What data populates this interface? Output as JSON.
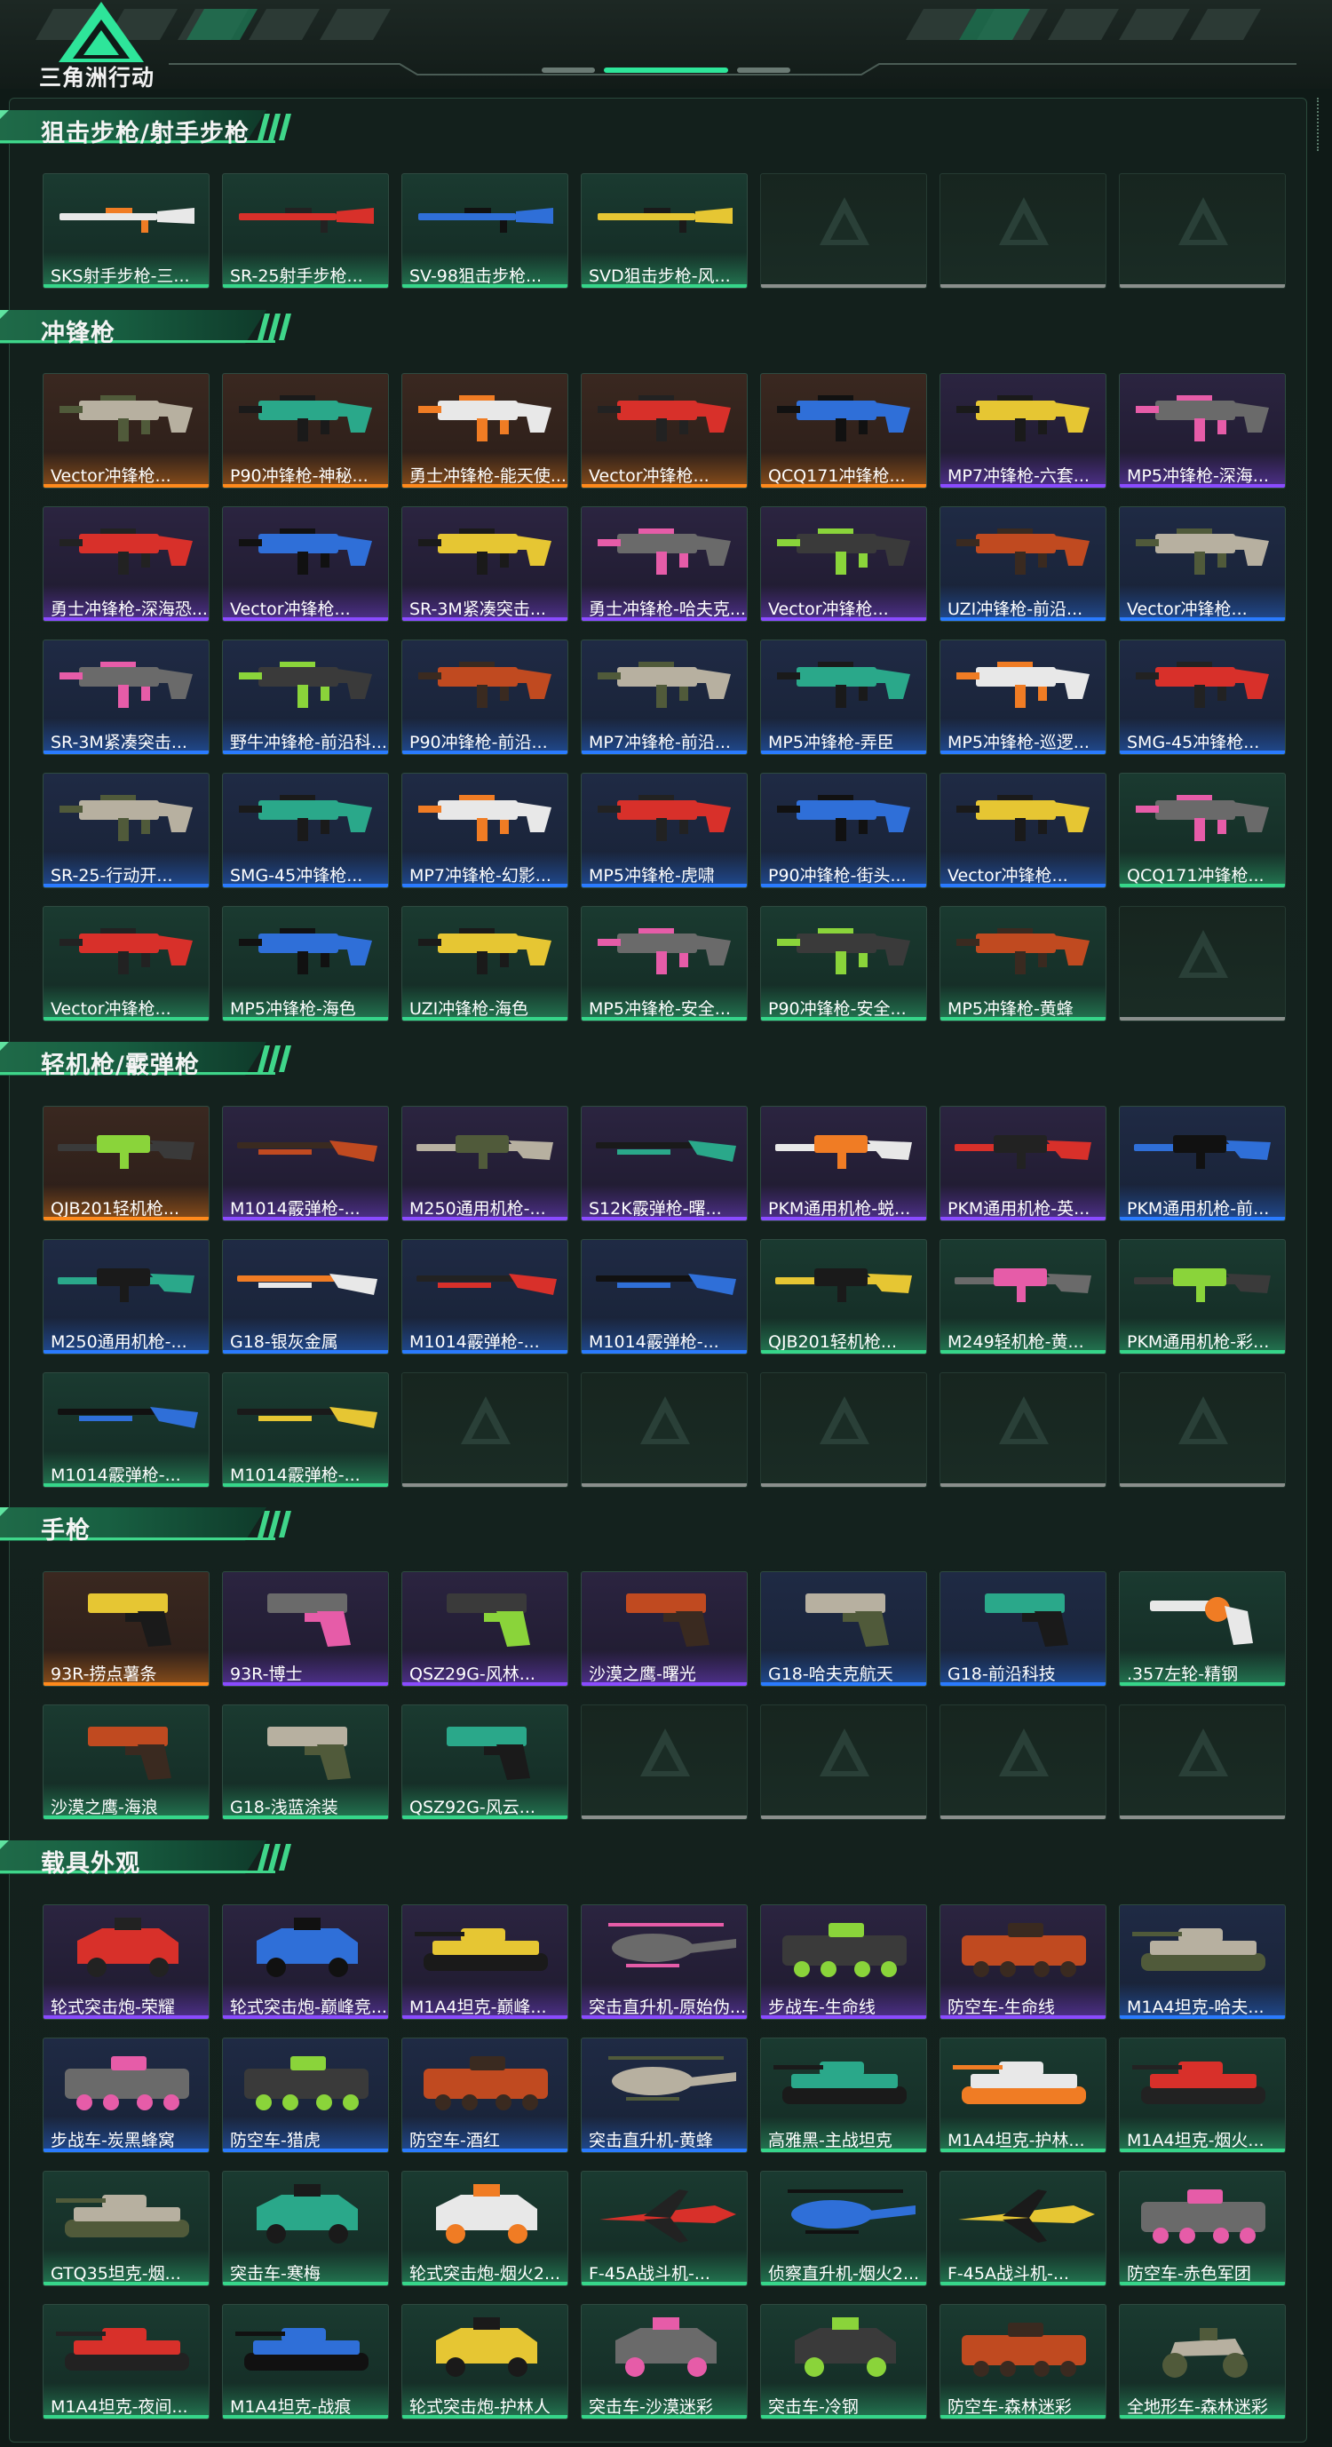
{
  "header": {
    "logo_text": "三角洲行动"
  },
  "rarity_colors": {
    "orange": "#ff8a1c",
    "purple": "#8a4bff",
    "blue": "#2a7bff",
    "green": "#36d68a",
    "gray": "#8a8f8c"
  },
  "sections": [
    {
      "title": "狙击步枪/射手步枪",
      "rows": [
        [
          {
            "name": "SKS射手步枪-三...",
            "r": "green",
            "icon": "rifle-icon"
          },
          {
            "name": "SR-25射手步枪...",
            "r": "green",
            "icon": "rifle-icon"
          },
          {
            "name": "SV-98狙击步枪...",
            "r": "green",
            "icon": "rifle-icon"
          },
          {
            "name": "SVD狙击步枪-风...",
            "r": "green",
            "icon": "rifle-icon"
          },
          null,
          null,
          null
        ]
      ]
    },
    {
      "title": "冲锋枪",
      "rows": [
        [
          {
            "name": "Vector冲锋枪...",
            "r": "orange",
            "icon": "smg-icon"
          },
          {
            "name": "P90冲锋枪-神秘...",
            "r": "orange",
            "icon": "smg-icon"
          },
          {
            "name": "勇士冲锋枪-能天使...",
            "r": "orange",
            "icon": "smg-icon"
          },
          {
            "name": "Vector冲锋枪...",
            "r": "orange",
            "icon": "smg-icon"
          },
          {
            "name": "QCQ171冲锋枪...",
            "r": "orange",
            "icon": "smg-icon"
          },
          {
            "name": "MP7冲锋枪-六套...",
            "r": "purple",
            "icon": "smg-icon"
          },
          {
            "name": "MP5冲锋枪-深海...",
            "r": "purple",
            "icon": "smg-icon"
          }
        ],
        [
          {
            "name": "勇士冲锋枪-深海恐...",
            "r": "purple",
            "icon": "smg-icon"
          },
          {
            "name": "Vector冲锋枪...",
            "r": "purple",
            "icon": "smg-icon"
          },
          {
            "name": "SR-3M紧凑突击...",
            "r": "purple",
            "icon": "smg-icon"
          },
          {
            "name": "勇士冲锋枪-哈夫克...",
            "r": "purple",
            "icon": "smg-icon"
          },
          {
            "name": "Vector冲锋枪...",
            "r": "purple",
            "icon": "smg-icon"
          },
          {
            "name": "UZI冲锋枪-前沿...",
            "r": "blue",
            "icon": "smg-icon"
          },
          {
            "name": "Vector冲锋枪...",
            "r": "blue",
            "icon": "smg-icon"
          }
        ],
        [
          {
            "name": "SR-3M紧凑突击...",
            "r": "blue",
            "icon": "smg-icon"
          },
          {
            "name": "野牛冲锋枪-前沿科...",
            "r": "blue",
            "icon": "smg-icon"
          },
          {
            "name": "P90冲锋枪-前沿...",
            "r": "blue",
            "icon": "smg-icon"
          },
          {
            "name": "MP7冲锋枪-前沿...",
            "r": "blue",
            "icon": "smg-icon"
          },
          {
            "name": "MP5冲锋枪-弄臣",
            "r": "blue",
            "icon": "smg-icon"
          },
          {
            "name": "MP5冲锋枪-巡逻...",
            "r": "blue",
            "icon": "smg-icon"
          },
          {
            "name": "SMG-45冲锋枪...",
            "r": "blue",
            "icon": "smg-icon"
          }
        ],
        [
          {
            "name": "SR-25-行动开...",
            "r": "blue",
            "icon": "smg-icon"
          },
          {
            "name": "SMG-45冲锋枪...",
            "r": "blue",
            "icon": "smg-icon"
          },
          {
            "name": "MP7冲锋枪-幻影...",
            "r": "blue",
            "icon": "smg-icon"
          },
          {
            "name": "MP5冲锋枪-虎啸",
            "r": "blue",
            "icon": "smg-icon"
          },
          {
            "name": "P90冲锋枪-街头...",
            "r": "blue",
            "icon": "smg-icon"
          },
          {
            "name": "Vector冲锋枪...",
            "r": "blue",
            "icon": "smg-icon"
          },
          {
            "name": "QCQ171冲锋枪...",
            "r": "green",
            "icon": "smg-icon"
          }
        ],
        [
          {
            "name": "Vector冲锋枪...",
            "r": "green",
            "icon": "smg-icon"
          },
          {
            "name": "MP5冲锋枪-海色",
            "r": "green",
            "icon": "smg-icon"
          },
          {
            "name": "UZI冲锋枪-海色",
            "r": "green",
            "icon": "smg-icon"
          },
          {
            "name": "MP5冲锋枪-安全...",
            "r": "green",
            "icon": "smg-icon"
          },
          {
            "name": "P90冲锋枪-安全...",
            "r": "green",
            "icon": "smg-icon"
          },
          {
            "name": "MP5冲锋枪-黄蜂",
            "r": "green",
            "icon": "smg-icon"
          },
          null
        ]
      ]
    },
    {
      "title": "轻机枪/霰弹枪",
      "rows": [
        [
          {
            "name": "QJB201轻机枪...",
            "r": "orange",
            "icon": "machine-gun-icon"
          },
          {
            "name": "M1014霰弹枪-...",
            "r": "purple",
            "icon": "shotgun-icon"
          },
          {
            "name": "M250通用机枪-...",
            "r": "purple",
            "icon": "machine-gun-icon"
          },
          {
            "name": "S12K霰弹枪-曙...",
            "r": "purple",
            "icon": "shotgun-icon"
          },
          {
            "name": "PKM通用机枪-蜕...",
            "r": "purple",
            "icon": "machine-gun-icon"
          },
          {
            "name": "PKM通用机枪-英...",
            "r": "purple",
            "icon": "machine-gun-icon"
          },
          {
            "name": "PKM通用机枪-前...",
            "r": "blue",
            "icon": "machine-gun-icon"
          }
        ],
        [
          {
            "name": "M250通用机枪-...",
            "r": "blue",
            "icon": "machine-gun-icon"
          },
          {
            "name": "G18-银灰金属",
            "r": "blue",
            "icon": "shotgun-icon"
          },
          {
            "name": "M1014霰弹枪-...",
            "r": "blue",
            "icon": "shotgun-icon"
          },
          {
            "name": "M1014霰弹枪-...",
            "r": "blue",
            "icon": "shotgun-icon"
          },
          {
            "name": "QJB201轻机枪...",
            "r": "green",
            "icon": "machine-gun-icon"
          },
          {
            "name": "M249轻机枪-黄...",
            "r": "green",
            "icon": "machine-gun-icon"
          },
          {
            "name": "PKM通用机枪-彩...",
            "r": "green",
            "icon": "machine-gun-icon"
          }
        ],
        [
          {
            "name": "M1014霰弹枪-...",
            "r": "green",
            "icon": "shotgun-icon"
          },
          {
            "name": "M1014霰弹枪-...",
            "r": "green",
            "icon": "shotgun-icon"
          },
          null,
          null,
          null,
          null,
          null
        ]
      ]
    },
    {
      "title": "手枪",
      "rows": [
        [
          {
            "name": "93R-捞点薯条",
            "r": "orange",
            "icon": "pistol-icon"
          },
          {
            "name": "93R-博士",
            "r": "purple",
            "icon": "pistol-icon"
          },
          {
            "name": "QSZ29G-风林...",
            "r": "purple",
            "icon": "pistol-icon"
          },
          {
            "name": "沙漠之鹰-曙光",
            "r": "purple",
            "icon": "pistol-icon"
          },
          {
            "name": "G18-哈夫克航天",
            "r": "blue",
            "icon": "pistol-icon"
          },
          {
            "name": "G18-前沿科技",
            "r": "blue",
            "icon": "pistol-icon"
          },
          {
            "name": ".357左轮-精钢",
            "r": "green",
            "icon": "revolver-icon"
          }
        ],
        [
          {
            "name": "沙漠之鹰-海浪",
            "r": "green",
            "icon": "pistol-icon"
          },
          {
            "name": "G18-浅蓝涂装",
            "r": "green",
            "icon": "pistol-icon"
          },
          {
            "name": "QSZ92G-风云...",
            "r": "green",
            "icon": "pistol-icon"
          },
          null,
          null,
          null,
          null
        ]
      ]
    },
    {
      "title": "载具外观",
      "rows": [
        [
          {
            "name": "轮式突击炮-荣耀",
            "r": "purple",
            "icon": "armored-car-icon"
          },
          {
            "name": "轮式突击炮-巅峰竞...",
            "r": "purple",
            "icon": "armored-car-icon"
          },
          {
            "name": "M1A4坦克-巅峰...",
            "r": "purple",
            "icon": "tank-icon"
          },
          {
            "name": "突击直升机-原始伪...",
            "r": "purple",
            "icon": "helicopter-icon"
          },
          {
            "name": "步战车-生命线",
            "r": "purple",
            "icon": "ifv-icon"
          },
          {
            "name": "防空车-生命线",
            "r": "purple",
            "icon": "ifv-icon"
          },
          {
            "name": "M1A4坦克-哈夫...",
            "r": "blue",
            "icon": "tank-icon"
          }
        ],
        [
          {
            "name": "步战车-炭黑蜂窝",
            "r": "blue",
            "icon": "ifv-icon"
          },
          {
            "name": "防空车-猎虎",
            "r": "blue",
            "icon": "ifv-icon"
          },
          {
            "name": "防空车-酒红",
            "r": "blue",
            "icon": "ifv-icon"
          },
          {
            "name": "突击直升机-黄蜂",
            "r": "blue",
            "icon": "helicopter-icon"
          },
          {
            "name": "高雅黑-主战坦克",
            "r": "green",
            "icon": "tank-icon"
          },
          {
            "name": "M1A4坦克-护林...",
            "r": "green",
            "icon": "tank-icon"
          },
          {
            "name": "M1A4坦克-烟火...",
            "r": "green",
            "icon": "tank-icon"
          }
        ],
        [
          {
            "name": "GTQ35坦克-烟...",
            "r": "green",
            "icon": "tank-icon"
          },
          {
            "name": "突击车-寒梅",
            "r": "green",
            "icon": "armored-car-icon"
          },
          {
            "name": "轮式突击炮-烟火2...",
            "r": "green",
            "icon": "armored-car-icon"
          },
          {
            "name": "F-45A战斗机-...",
            "r": "green",
            "icon": "fighter-jet-icon"
          },
          {
            "name": "侦察直升机-烟火2...",
            "r": "green",
            "icon": "helicopter-icon"
          },
          {
            "name": "F-45A战斗机-...",
            "r": "green",
            "icon": "fighter-jet-icon"
          },
          {
            "name": "防空车-赤色军团",
            "r": "green",
            "icon": "ifv-icon"
          }
        ],
        [
          {
            "name": "M1A4坦克-夜间...",
            "r": "green",
            "icon": "tank-icon"
          },
          {
            "name": "M1A4坦克-战痕",
            "r": "green",
            "icon": "tank-icon"
          },
          {
            "name": "轮式突击炮-护林人",
            "r": "green",
            "icon": "armored-car-icon"
          },
          {
            "name": "突击车-沙漠迷彩",
            "r": "green",
            "icon": "armored-car-icon"
          },
          {
            "name": "突击车-冷钢",
            "r": "green",
            "icon": "armored-car-icon"
          },
          {
            "name": "防空车-森林迷彩",
            "r": "green",
            "icon": "ifv-icon"
          },
          {
            "name": "全地形车-森林迷彩",
            "r": "green",
            "icon": "atv-icon"
          }
        ]
      ]
    }
  ]
}
